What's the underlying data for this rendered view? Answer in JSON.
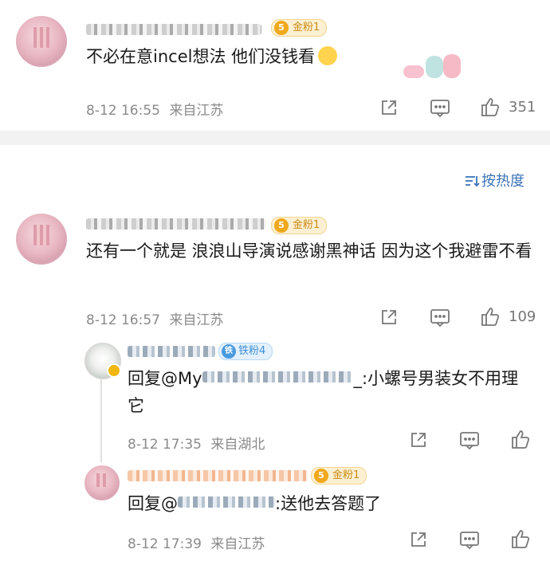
{
  "comments": [
    {
      "text": "不必在意incel想法 他们没钱看",
      "badge": "金粉1",
      "badge_level": "5",
      "time": "8-12 16:55",
      "location": "来自江苏",
      "likes": "351"
    },
    {
      "text": "还有一个就是 浪浪山导演说感谢黑神话 因为这个我避雷不看",
      "badge": "金粉1",
      "badge_level": "5",
      "time": "8-12 16:57",
      "location": "来自江苏",
      "likes": "109"
    }
  ],
  "replies": [
    {
      "prefix": "回复@My",
      "suffix": "_:小螺号男装女不用理它",
      "badge": "铁粉4",
      "time": "8-12 17:35",
      "location": "来自湖北"
    },
    {
      "prefix": "回复@",
      "suffix": ":送他去答题了",
      "badge": "金粉1",
      "badge_level": "5",
      "time": "8-12 17:39",
      "location": "来自江苏"
    }
  ],
  "sort": {
    "label": "按热度"
  },
  "colors": {
    "link": "#3b74b8",
    "gold": "#f0a81c",
    "iron": "#4a9be0"
  }
}
